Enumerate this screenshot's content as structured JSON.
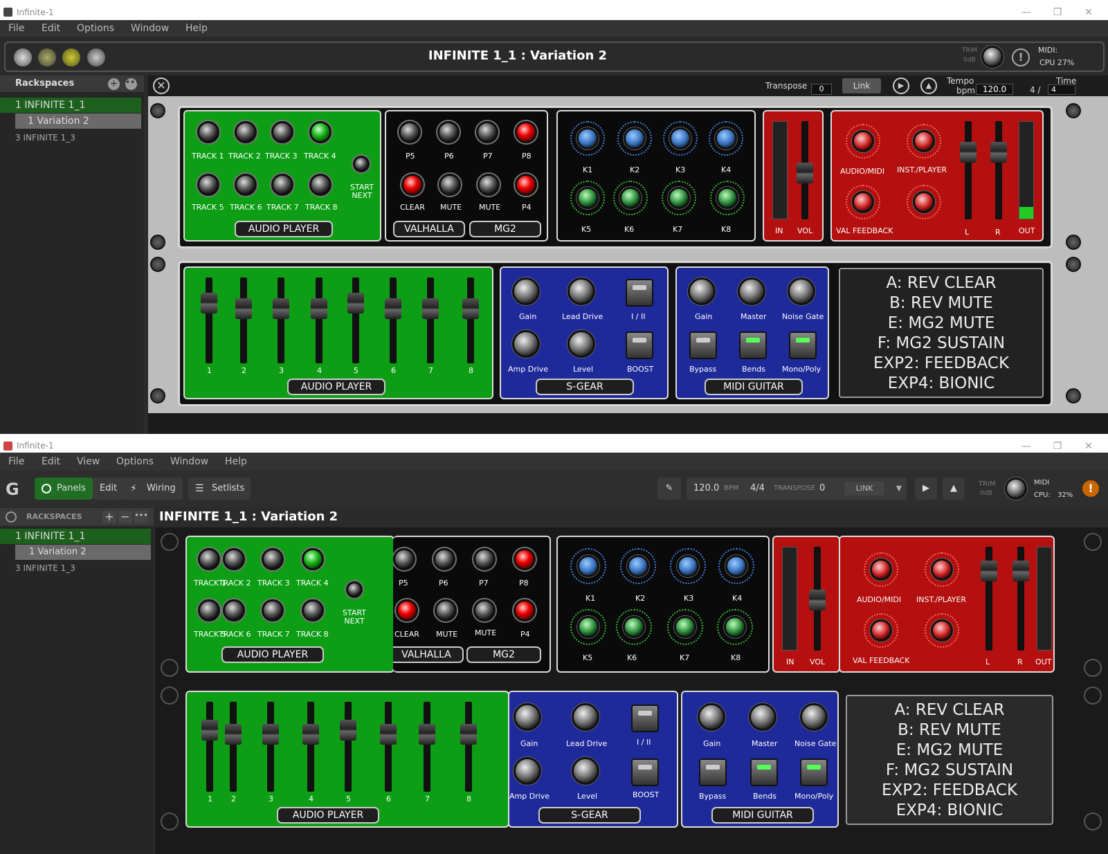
{
  "top": {
    "window_title": "Infinite-1",
    "menu": [
      "File",
      "Edit",
      "Options",
      "Window",
      "Help"
    ],
    "rack_title": "INFINITE 1_1 : Variation 2",
    "trim_label": "TRIM",
    "trim_value": "0dB",
    "midi_label": "MIDI:",
    "cpu_label": "CPU 27%",
    "sidebar_title": "Rackspaces",
    "rackspaces": [
      "1 INFINITE 1_1",
      "1  Variation 2",
      "3 INFINITE 1_3"
    ],
    "transpose_label": "Transpose",
    "transpose_value": "0",
    "link_label": "Link",
    "tempo_label": "Tempo",
    "bpm_label": "bpm",
    "tempo_value": "120.0",
    "time_label": "Time",
    "time_sig": "4 /",
    "time_den": "4"
  },
  "bottom": {
    "window_title": "Infinite-1",
    "menu": [
      "File",
      "Edit",
      "View",
      "Options",
      "Window",
      "Help"
    ],
    "tabs": [
      "Panels",
      "Edit",
      "Wiring",
      "Setlists"
    ],
    "tempo": "120.0",
    "bpm_label": "BPM",
    "time_sig": "4/4",
    "transpose_label": "TRANSPOSE",
    "transpose_value": "0",
    "link_label": "LINK",
    "trim_label": "TRIM",
    "trim_value": "0dB",
    "midi_label": "MIDI",
    "cpu_label": "CPU:",
    "cpu_value": "32%",
    "sidebar_title": "RACKSPACES",
    "rackspaces": [
      "1  INFINITE 1_1",
      "1  Variation 2",
      "3  INFINITE 1_3"
    ],
    "rack_title": "INFINITE 1_1 : Variation 2"
  },
  "panels": {
    "audio_player_tracks": [
      "TRACK 1",
      "TRACK 2",
      "TRACK 3",
      "TRACK 4",
      "TRACK 5",
      "TRACK 6",
      "TRACK 7",
      "TRACK 8"
    ],
    "start_next": "START NEXT",
    "audio_player": "AUDIO PLAYER",
    "valhalla_buttons": [
      "P5",
      "P6",
      "P7",
      "P8",
      "CLEAR",
      "MUTE",
      "MUTE",
      "P4"
    ],
    "valhalla": "VALHALLA",
    "mg2": "MG2",
    "knobs": [
      "K1",
      "K2",
      "K3",
      "K4",
      "K5",
      "K6",
      "K7",
      "K8"
    ],
    "in": "IN",
    "vol": "VOL",
    "red_knobs": [
      "AUDIO/MIDI",
      "INST./PLAYER",
      "VAL FEEDBACK"
    ],
    "l": "L",
    "r": "R",
    "out": "OUT",
    "mixer_channels": [
      "1",
      "2",
      "3",
      "4",
      "5",
      "6",
      "7",
      "8"
    ],
    "sgear_knobs": [
      "Gain",
      "Lead Drive",
      "Amp Drive",
      "Level"
    ],
    "sgear_btns": [
      "I / II",
      "BOOST"
    ],
    "sgear": "S-GEAR",
    "midi_guitar_knobs": [
      "Gain",
      "Master",
      "Noise Gate"
    ],
    "midi_guitar_btns": [
      "Bypass",
      "Bends",
      "Mono/Poly"
    ],
    "midi_guitar": "MIDI GUITAR",
    "info_lines": [
      "A: REV CLEAR",
      "B: REV MUTE",
      "E: MG2 MUTE",
      "F: MG2 SUSTAIN",
      "EXP2: FEEDBACK",
      "EXP4: BIONIC"
    ]
  }
}
